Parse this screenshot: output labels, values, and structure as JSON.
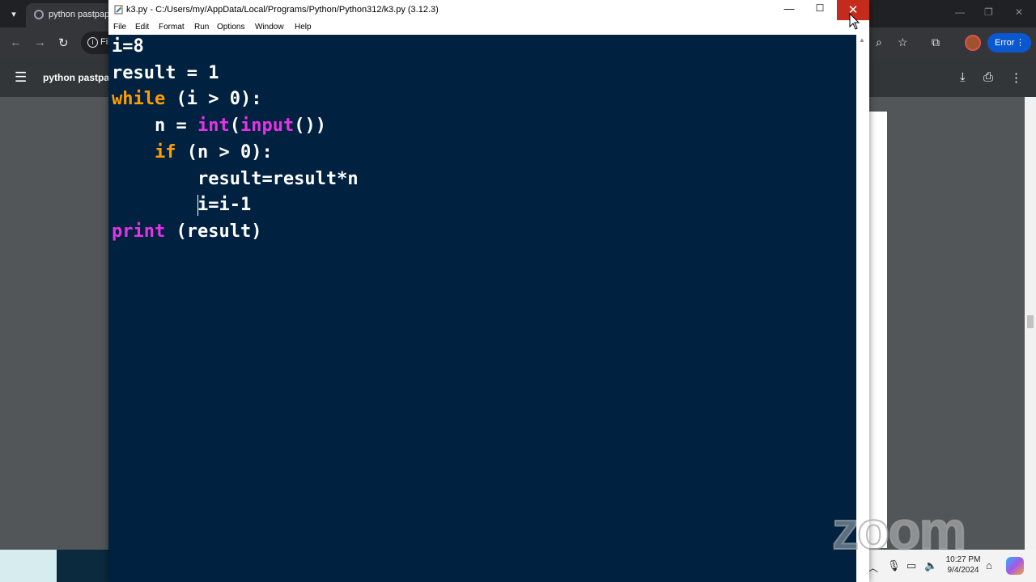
{
  "browser": {
    "tab_title": "python pastpape",
    "omnibox_text": "Fil",
    "pdf_title": "python pastpap",
    "error_label": "Error"
  },
  "idle": {
    "title": "k3.py - C:/Users/my/AppData/Local/Programs/Python/Python312/k3.py (3.12.3)",
    "menu": [
      "File",
      "Edit",
      "Format",
      "Run",
      "Options",
      "Window",
      "Help"
    ],
    "code": [
      {
        "indent": "",
        "parts": [
          {
            "t": "i=8",
            "c": "plain"
          }
        ]
      },
      {
        "indent": "",
        "parts": [
          {
            "t": "result = 1",
            "c": "plain"
          }
        ]
      },
      {
        "indent": "",
        "parts": [
          {
            "t": "while",
            "c": "orange"
          },
          {
            "t": " (i > 0):",
            "c": "plain"
          }
        ]
      },
      {
        "indent": "    ",
        "parts": [
          {
            "t": "n = ",
            "c": "plain"
          },
          {
            "t": "int",
            "c": "magenta"
          },
          {
            "t": "(",
            "c": "plain"
          },
          {
            "t": "input",
            "c": "magenta"
          },
          {
            "t": "())",
            "c": "plain"
          }
        ]
      },
      {
        "indent": "    ",
        "parts": [
          {
            "t": "if",
            "c": "orange"
          },
          {
            "t": " (n > 0):",
            "c": "plain"
          }
        ]
      },
      {
        "indent": "        ",
        "parts": [
          {
            "t": "result=result*n",
            "c": "plain"
          }
        ]
      },
      {
        "indent": "        ",
        "parts": [
          {
            "t": "i=i-1",
            "c": "plain"
          }
        ],
        "caret": true
      },
      {
        "indent": "",
        "parts": [
          {
            "t": "print",
            "c": "magenta"
          },
          {
            "t": " (result)",
            "c": "plain"
          }
        ]
      }
    ]
  },
  "taskbar": {
    "time": "10:27 PM",
    "date": "9/4/2024"
  },
  "watermark": "zoom",
  "colors": {
    "editor_bg": "#002240",
    "keyword": "#ff9d00",
    "builtin": "#e434e4",
    "close_button": "#c42b1c"
  }
}
